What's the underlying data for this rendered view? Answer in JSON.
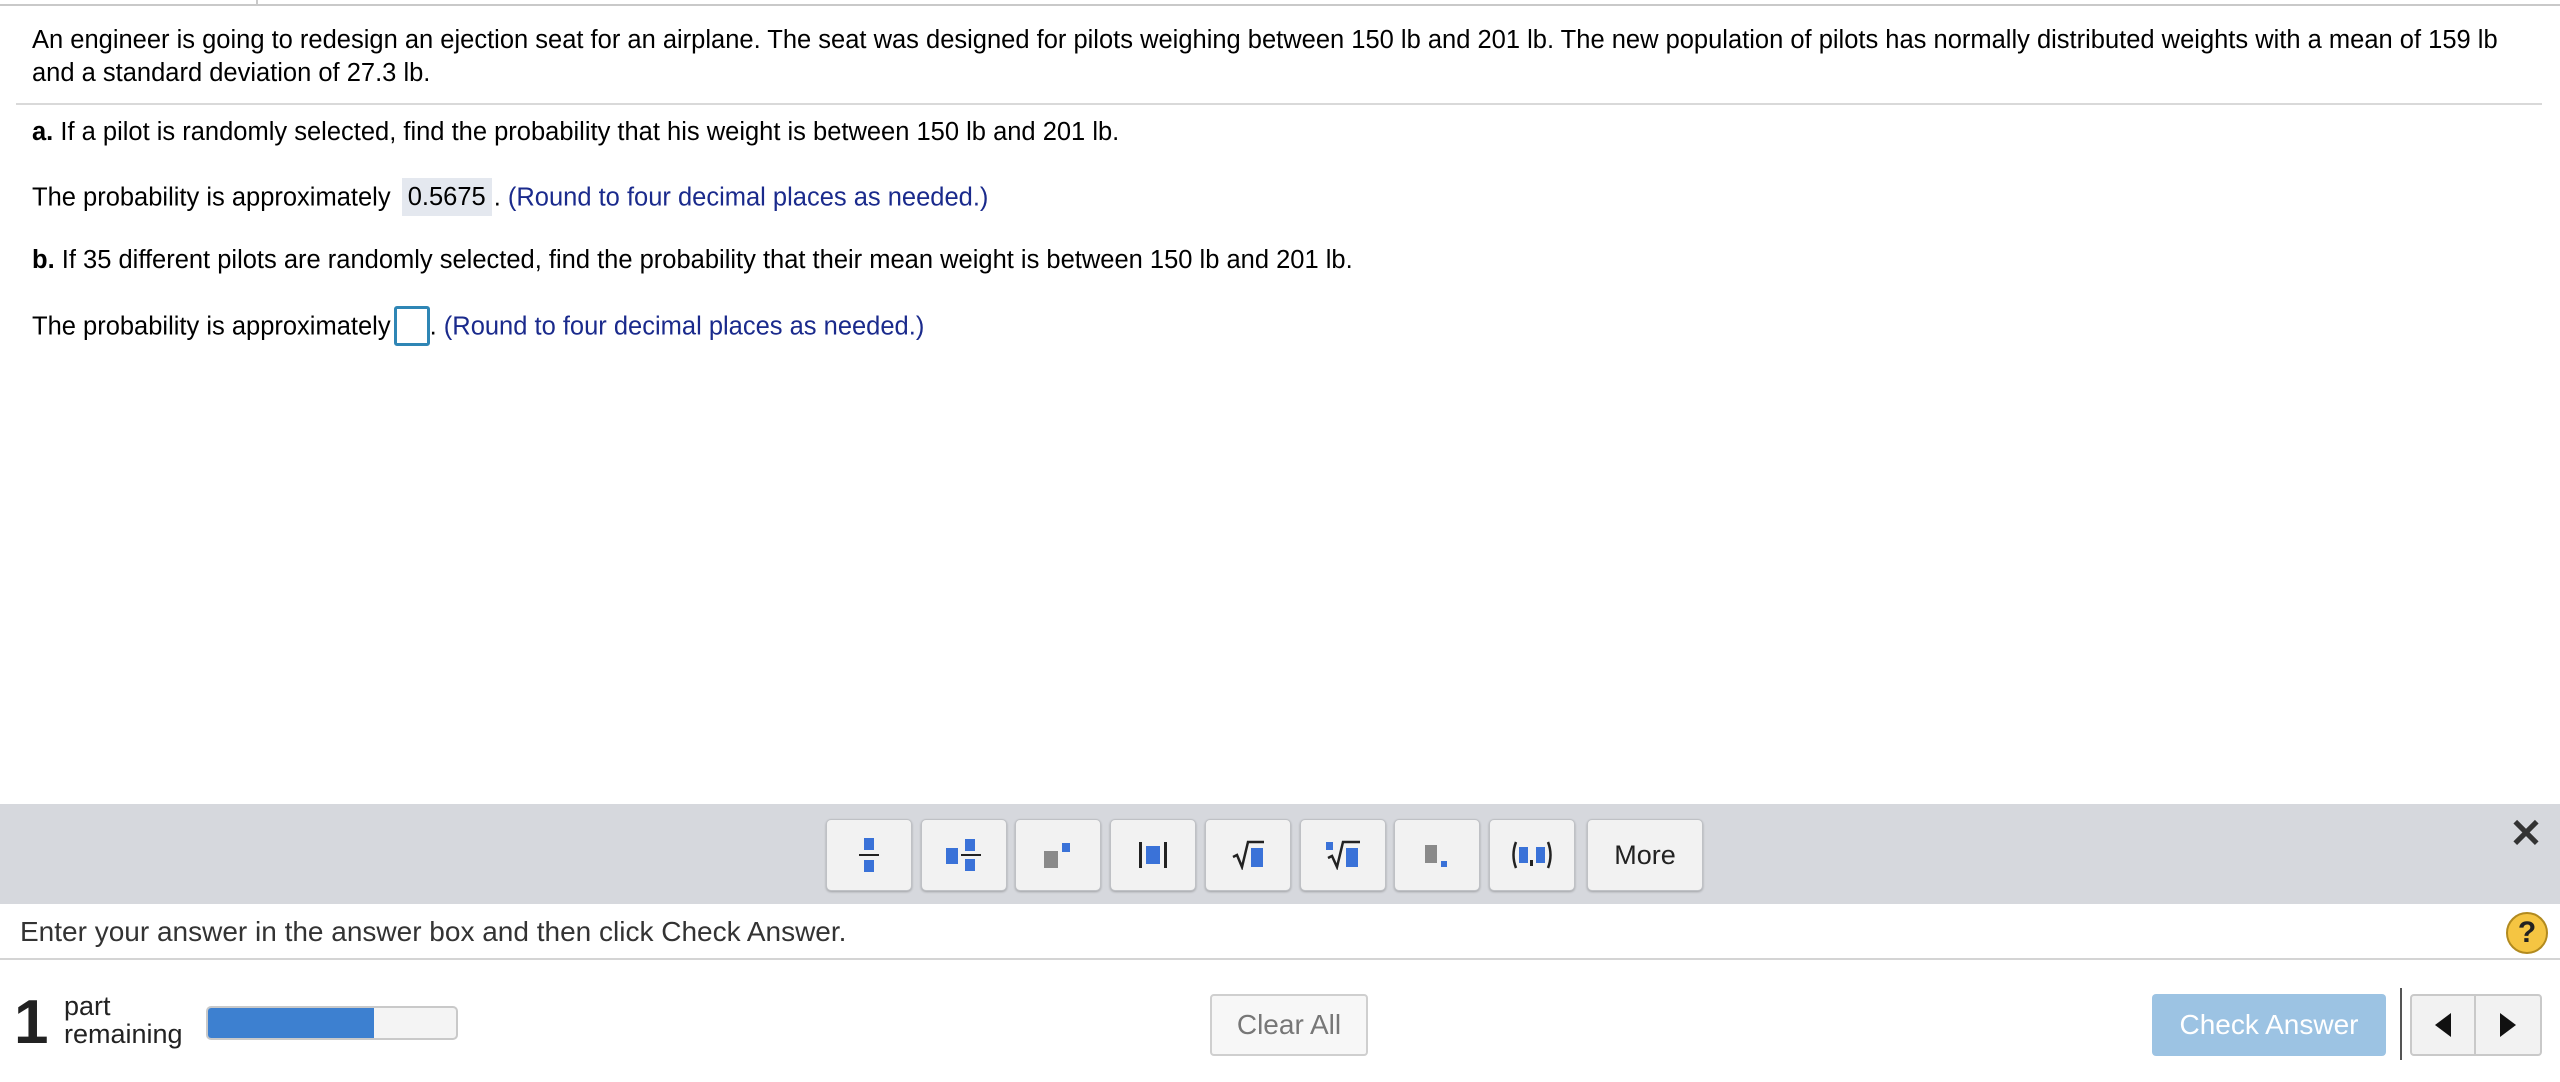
{
  "question": {
    "text": "An engineer is going to redesign an ejection seat for an airplane. The seat was designed for pilots weighing between 150 lb and 201 lb. The new population of pilots has normally distributed weights with a mean of 159 lb and a standard deviation of 27.3 lb."
  },
  "part_a": {
    "label": "a.",
    "prompt": "If a pilot is randomly selected, find the probability that his weight is between 150 lb and 201 lb.",
    "answer_prefix": "The probability is approximately",
    "answer_value": "0.5675",
    "answer_suffix": ".",
    "hint": "(Round to four decimal places as needed.)"
  },
  "part_b": {
    "label": "b.",
    "prompt": "If 35 different pilots are randomly selected, find the probability that their mean weight  is between 150 lb and 201 lb.",
    "answer_prefix": "The probability is approximately",
    "answer_value": "",
    "answer_suffix": ".",
    "hint": "(Round to four decimal places as needed.)"
  },
  "toolbar": {
    "buttons": [
      {
        "icon": "fraction-icon"
      },
      {
        "icon": "mixed-number-icon"
      },
      {
        "icon": "exponent-icon"
      },
      {
        "icon": "absolute-value-icon"
      },
      {
        "icon": "square-root-icon"
      },
      {
        "icon": "nth-root-icon"
      },
      {
        "icon": "decimal-icon"
      },
      {
        "icon": "ordered-pair-icon"
      }
    ],
    "more_label": "More",
    "close_icon": "close-icon",
    "accent_color": "#3a72d8"
  },
  "instruction": {
    "text": "Enter your answer in the answer box and then click Check Answer.",
    "help_label": "?"
  },
  "footer": {
    "parts_count": "1",
    "parts_label_line1": "part",
    "parts_label_line2": "remaining",
    "progress_fraction": 0.67,
    "progress_color": "#3d80d0",
    "clear_all_label": "Clear All",
    "check_answer_label": "Check Answer"
  }
}
